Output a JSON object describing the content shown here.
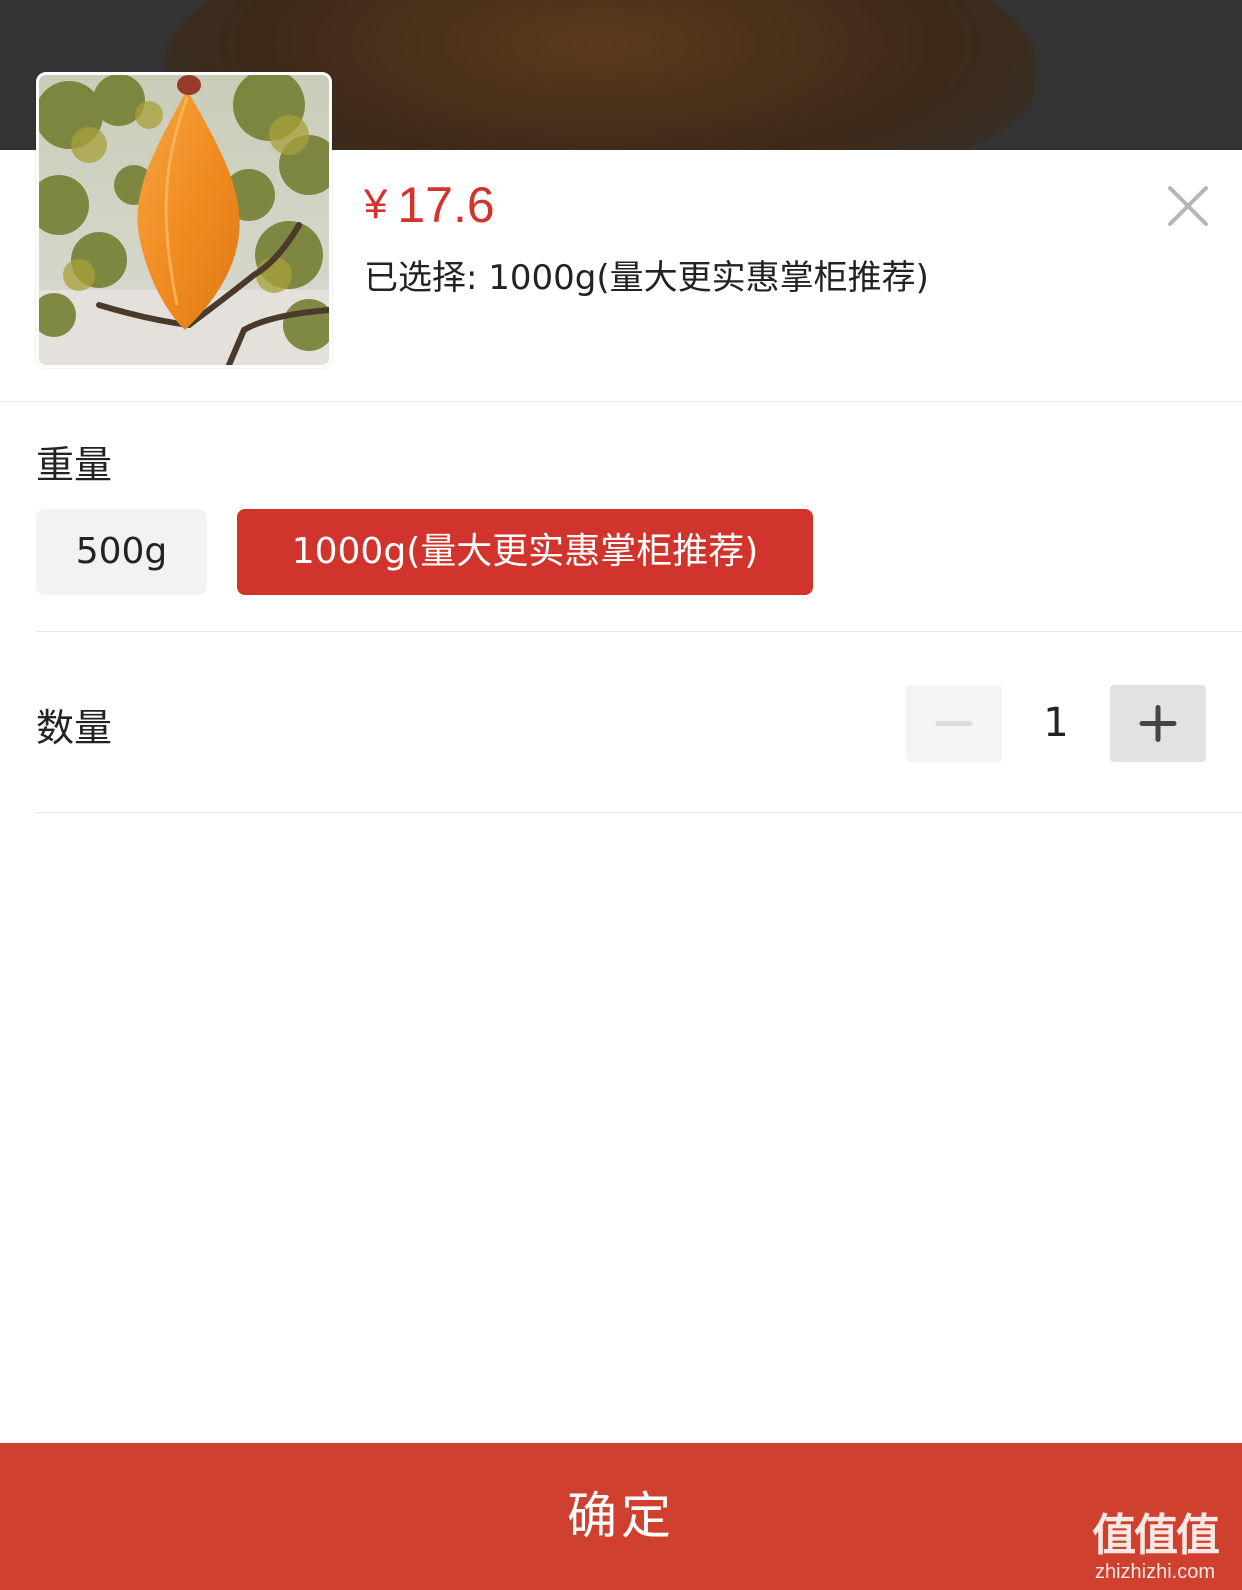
{
  "product": {
    "image_icon": "dried-sweet-potato-photo",
    "price_symbol": "¥",
    "price": "17.6",
    "selected_text": "已选择: 1000g(量大更实惠掌柜推荐)"
  },
  "close_icon": "close-icon",
  "weight": {
    "label": "重量",
    "options": [
      {
        "label": "500g",
        "selected": false
      },
      {
        "label": "1000g(量大更实惠掌柜推荐)",
        "selected": true
      }
    ]
  },
  "quantity": {
    "label": "数量",
    "value": "1",
    "minus_icon": "minus-icon",
    "plus_icon": "plus-icon",
    "minus_enabled": false
  },
  "confirm_label": "确定",
  "watermark": {
    "big": "值值值",
    "small": "zhizhizhi.com"
  },
  "colors": {
    "accent": "#d0342c",
    "confirm_bg": "#d0402f",
    "option_bg": "#f2f2f2",
    "backdrop": "#333333"
  }
}
